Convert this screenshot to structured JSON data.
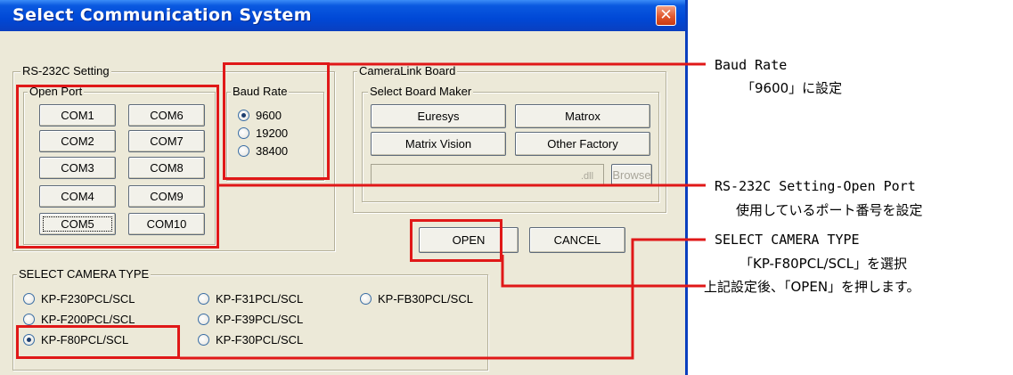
{
  "dialog": {
    "title": "Select Communication System",
    "close_glyph": "✕",
    "rs232c": {
      "group_label": "RS-232C Setting",
      "open_port": {
        "label": "Open Port",
        "ports": [
          "COM1",
          "COM6",
          "COM2",
          "COM7",
          "COM3",
          "COM8",
          "COM4",
          "COM9",
          "COM5",
          "COM10"
        ],
        "focused_port": "COM5"
      },
      "baud_rate": {
        "label": "Baud Rate",
        "options": [
          "9600",
          "19200",
          "38400"
        ],
        "selected": "9600"
      }
    },
    "cameralink": {
      "group_label": "CameraLink Board",
      "maker_label": "Select Board Maker",
      "makers": [
        "Euresys",
        "Matrox",
        "Matrix Vision",
        "Other Factory"
      ],
      "dll_suffix": ".dll",
      "browse_label": "Browse"
    },
    "open_label": "OPEN",
    "cancel_label": "CANCEL",
    "camera_type": {
      "label": "SELECT CAMERA TYPE",
      "options": [
        "KP-F230PCL/SCL",
        "KP-F31PCL/SCL",
        "KP-FB30PCL/SCL",
        "KP-F200PCL/SCL",
        "KP-F39PCL/SCL",
        "KP-F80PCL/SCL",
        "KP-F30PCL/SCL"
      ],
      "selected": "KP-F80PCL/SCL"
    }
  },
  "annotations": {
    "baud_title": "Baud Rate",
    "baud_desc": "「9600」に設定",
    "port_title": "RS-232C Setting-Open Port",
    "port_desc": "使用しているポート番号を設定",
    "camera_title": "SELECT CAMERA TYPE",
    "camera_desc": "「KP-F80PCL/SCL」を選択",
    "open_note": "上記設定後、「OPEN」を押します。"
  },
  "colors": {
    "highlight": "#e01818",
    "titlebar": "#0a59e0",
    "dialog_bg": "#ece9d8"
  }
}
